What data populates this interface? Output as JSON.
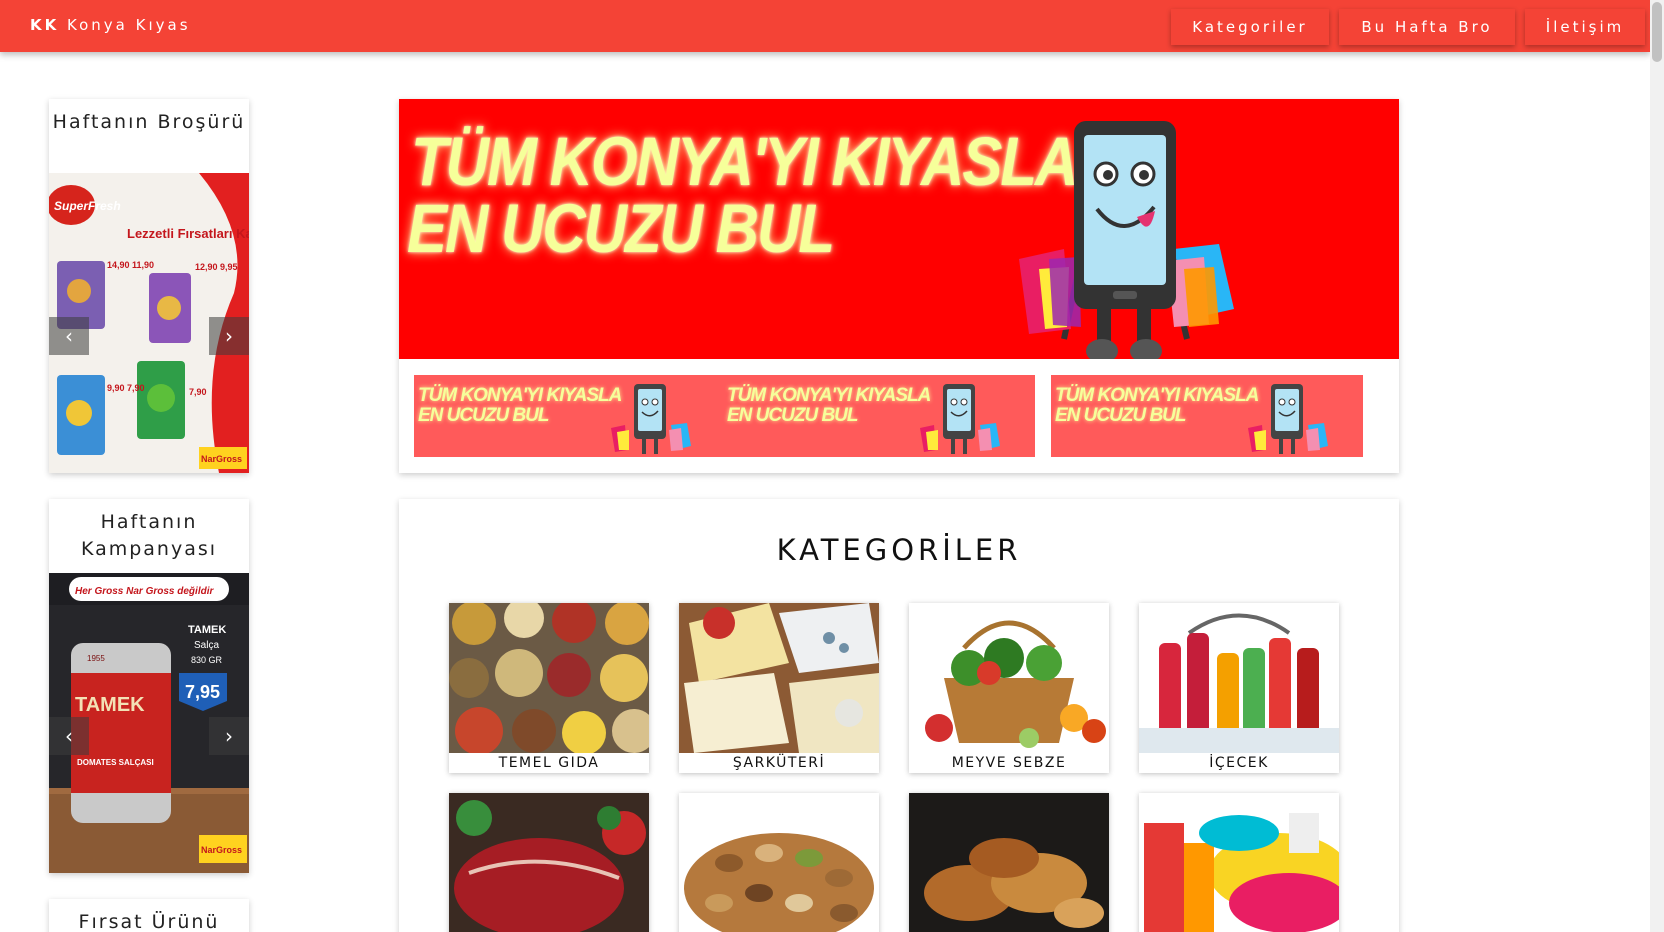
{
  "navbar": {
    "brand_bold": "KK",
    "brand_rest": "Konya Kıyas",
    "links": [
      "Kategoriler",
      "Bu Hafta Bro",
      "İletişim"
    ]
  },
  "sidebar": {
    "brochure_title": "Haftanın Broşürü",
    "brochure_image": {
      "brand": "SuperFresh",
      "headline": "Lezzetli Fırsatları Kaçırma!",
      "store": "NarGross",
      "prices": [
        "14,90 11,90",
        "12,90 9,95",
        "9,90 7,90",
        "7,90"
      ]
    },
    "campaign_title": "Haftanın Kampanyası",
    "campaign_image": {
      "slogan": "Her Gross Nar Gross değildir",
      "product": "TAMEK",
      "product_sub": "Salça",
      "weight": "830 GR",
      "price": "7,95",
      "label": "TAMEK",
      "label_sub": "DOMATES SALÇASI",
      "year": "1955",
      "store": "NarGross"
    },
    "opportunity_title": "Fırsat Ürünü",
    "prev_glyph": "‹",
    "next_glyph": "›"
  },
  "banner": {
    "line1": "TÜM KONYA'YI KIYASLA",
    "line2": "EN UCUZU BUL",
    "thumbs": [
      {
        "line1": "TÜM KONYA'YI KIYASLA",
        "line2": "EN UCUZU BUL"
      },
      {
        "line1": "TÜM KONYA'YI KIYASLA",
        "line2": "EN UCUZU BUL"
      },
      {
        "line1": "TÜM KONYA'YI KIYASLA",
        "line2": "EN UCUZU BUL"
      }
    ]
  },
  "categories": {
    "heading": "KATEGORİLER",
    "items": [
      {
        "label": "TEMEL GIDA",
        "icon": "spices-photo"
      },
      {
        "label": "ŞARKÜTERİ",
        "icon": "cheese-photo"
      },
      {
        "label": "MEYVE SEBZE",
        "icon": "fruit-basket-photo"
      },
      {
        "label": "İÇECEK",
        "icon": "drinks-photo"
      },
      {
        "label": "",
        "icon": "meat-photo"
      },
      {
        "label": "",
        "icon": "nuts-photo"
      },
      {
        "label": "",
        "icon": "bread-photo"
      },
      {
        "label": "",
        "icon": "plasticware-photo"
      }
    ]
  },
  "colors": {
    "accent": "#f44336",
    "hero_red": "#ff0000",
    "hero_text": "#f6ff9a"
  }
}
